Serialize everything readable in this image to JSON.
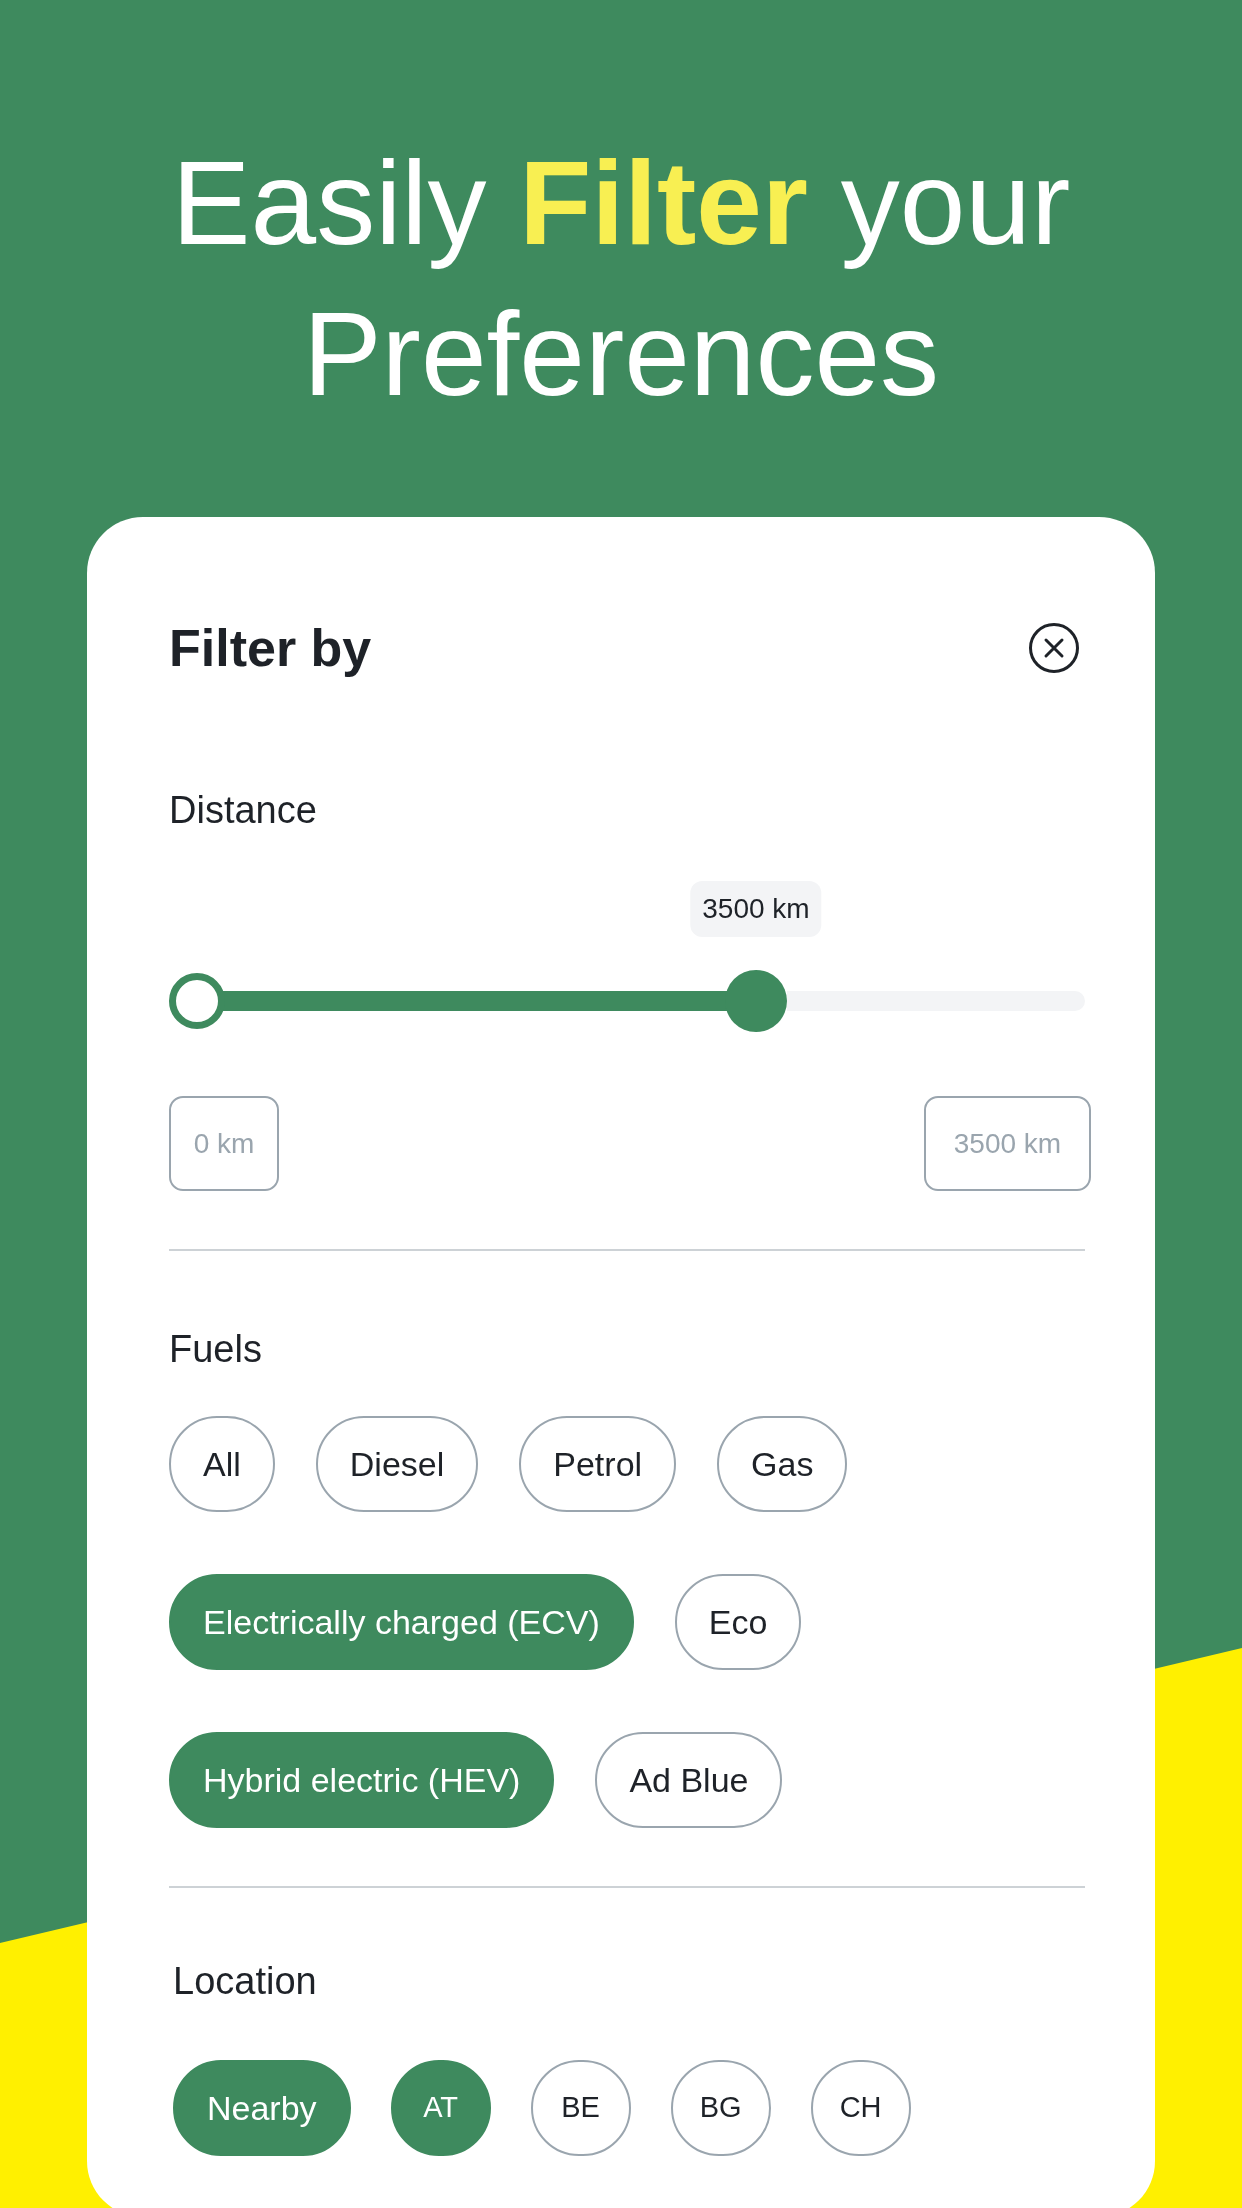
{
  "headline": "Easily **Filter** your Preferences",
  "panel": {
    "title": "Filter by",
    "distance": {
      "label": "Distance",
      "tooltip": "3500 km",
      "thumbs": [
        {
          "level": 0
        },
        {
          "level": 0.65
        }
      ],
      "min_field": {
        "placeholder": "0 km"
      },
      "max_field": {
        "placeholder": "3500 km"
      }
    },
    "fuels": {
      "label": "Fuels",
      "rows": [
        {
          "chips": [
            {
              "label": "All",
              "selected": false
            },
            {
              "label": "Diesel",
              "selected": false
            },
            {
              "label": "Petrol",
              "selected": false
            },
            {
              "label": "Gas",
              "selected": false
            }
          ]
        },
        {
          "chips": [
            {
              "label": "Electrically charged (ECV)",
              "selected": true
            },
            {
              "label": "Eco",
              "selected": false
            }
          ]
        },
        {
          "chips": [
            {
              "label": "Hybrid electric (HEV)",
              "selected": true
            },
            {
              "label": "Ad Blue",
              "selected": false
            }
          ]
        }
      ]
    },
    "location": {
      "label": "Location",
      "chips": [
        {
          "label": "Nearby",
          "selected": true,
          "kind": "pill"
        },
        {
          "label": "AT",
          "selected": true,
          "kind": "circle"
        },
        {
          "label": "BE",
          "selected": false,
          "kind": "circle"
        },
        {
          "label": "BG",
          "selected": false,
          "kind": "circle"
        },
        {
          "label": "CH",
          "selected": false,
          "kind": "circle"
        }
      ]
    }
  }
}
